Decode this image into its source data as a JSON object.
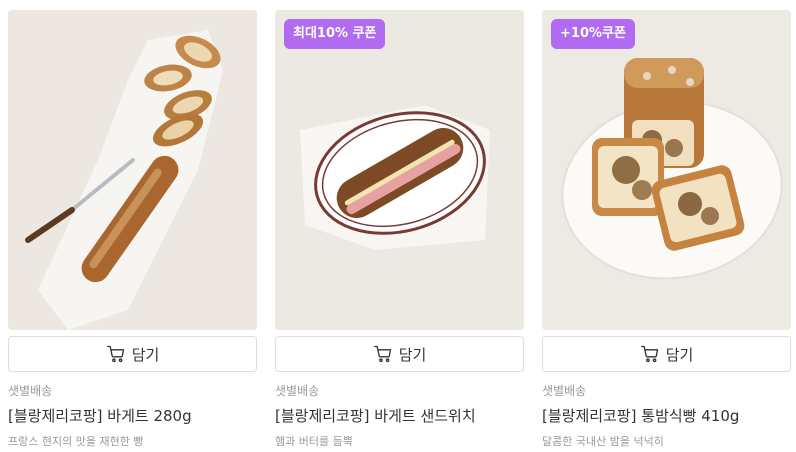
{
  "products": [
    {
      "badge": "",
      "cart_label": "담기",
      "delivery": "샛별배송",
      "name": "[블랑제리코팡] 바게트 280g",
      "description": "프랑스 현지의 맛을 재현한 빵",
      "image": "baguette-photo"
    },
    {
      "badge": "최대10% 쿠폰",
      "cart_label": "담기",
      "delivery": "샛별배송",
      "name": "[블랑제리코팡] 바게트 샌드위치",
      "description": "햄과 버터를 듬뿍",
      "image": "baguette-sandwich-photo"
    },
    {
      "badge": "+10%쿠폰",
      "cart_label": "담기",
      "delivery": "샛별배송",
      "name": "[블랑제리코팡] 통밤식빵 410g",
      "description": "달콤한 국내산 밤을 넉넉히",
      "image": "chestnut-bread-photo"
    }
  ],
  "colors": {
    "badge_bg": "#b06bf0",
    "muted_text": "#999999",
    "primary_text": "#333333",
    "button_border": "#dddddd"
  },
  "icons": {
    "cart": "cart-icon"
  }
}
